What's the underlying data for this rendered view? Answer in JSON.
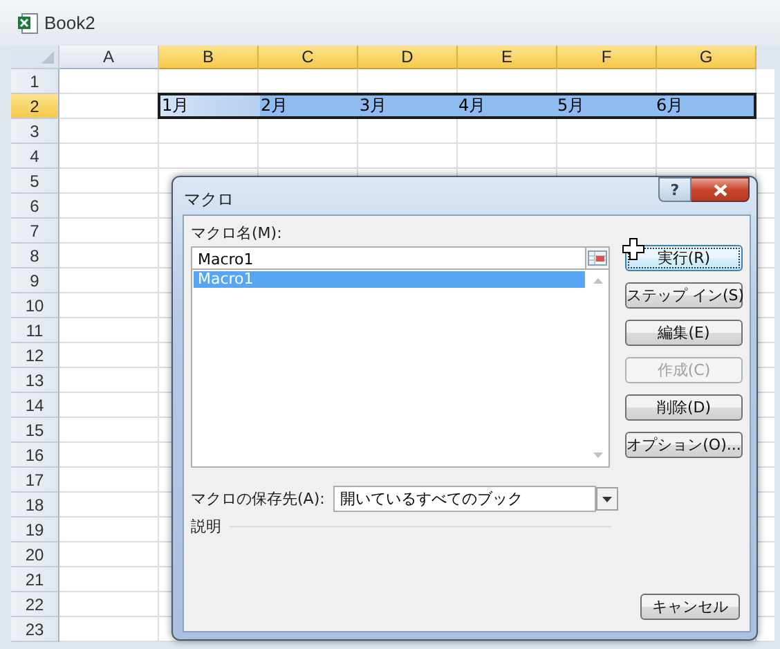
{
  "window": {
    "title": "Book2"
  },
  "sheet": {
    "columns": [
      {
        "label": "A",
        "selected": false
      },
      {
        "label": "B",
        "selected": true
      },
      {
        "label": "C",
        "selected": true
      },
      {
        "label": "D",
        "selected": true
      },
      {
        "label": "E",
        "selected": true
      },
      {
        "label": "F",
        "selected": true
      },
      {
        "label": "G",
        "selected": true
      }
    ],
    "rows": [
      {
        "label": "1",
        "selected": false
      },
      {
        "label": "2",
        "selected": true,
        "cells": [
          null,
          {
            "text": "1月",
            "selected": true,
            "active": true
          },
          {
            "text": "2月",
            "selected": true,
            "active": false
          },
          {
            "text": "3月",
            "selected": true,
            "active": false
          },
          {
            "text": "4月",
            "selected": true,
            "active": false
          },
          {
            "text": "5月",
            "selected": true,
            "active": false
          },
          {
            "text": "6月",
            "selected": true,
            "active": false
          }
        ]
      },
      {
        "label": "3",
        "selected": false
      },
      {
        "label": "4",
        "selected": false
      },
      {
        "label": "5",
        "selected": false
      },
      {
        "label": "6",
        "selected": false
      },
      {
        "label": "7",
        "selected": false
      },
      {
        "label": "8",
        "selected": false
      },
      {
        "label": "9",
        "selected": false
      },
      {
        "label": "10",
        "selected": false
      },
      {
        "label": "11",
        "selected": false
      },
      {
        "label": "12",
        "selected": false
      },
      {
        "label": "13",
        "selected": false
      },
      {
        "label": "14",
        "selected": false
      },
      {
        "label": "15",
        "selected": false
      },
      {
        "label": "16",
        "selected": false
      },
      {
        "label": "17",
        "selected": false
      },
      {
        "label": "18",
        "selected": false
      },
      {
        "label": "19",
        "selected": false
      },
      {
        "label": "20",
        "selected": false
      },
      {
        "label": "21",
        "selected": false
      },
      {
        "label": "22",
        "selected": false
      },
      {
        "label": "23",
        "selected": false
      }
    ]
  },
  "dialog": {
    "title": "マクロ",
    "help_button": "?",
    "name_label": "マクロ名(M):",
    "name_field": {
      "value": "Macro1"
    },
    "macro_list": {
      "items": [
        {
          "label": "Macro1",
          "selected": true
        }
      ]
    },
    "buttons": [
      {
        "label": "実行(R)",
        "default": true,
        "disabled": false
      },
      {
        "label": "ステップ イン(S)",
        "default": false,
        "disabled": false
      },
      {
        "label": "編集(E)",
        "default": false,
        "disabled": false
      },
      {
        "label": "作成(C)",
        "default": false,
        "disabled": true
      },
      {
        "label": "削除(D)",
        "default": false,
        "disabled": false
      },
      {
        "label": "オプション(O)...",
        "default": false,
        "disabled": false
      }
    ],
    "location_label": "マクロの保存先(A):",
    "location_dropdown": {
      "value": "開いているすべてのブック"
    },
    "description_label": "説明",
    "cancel_button": "キャンセル"
  }
}
